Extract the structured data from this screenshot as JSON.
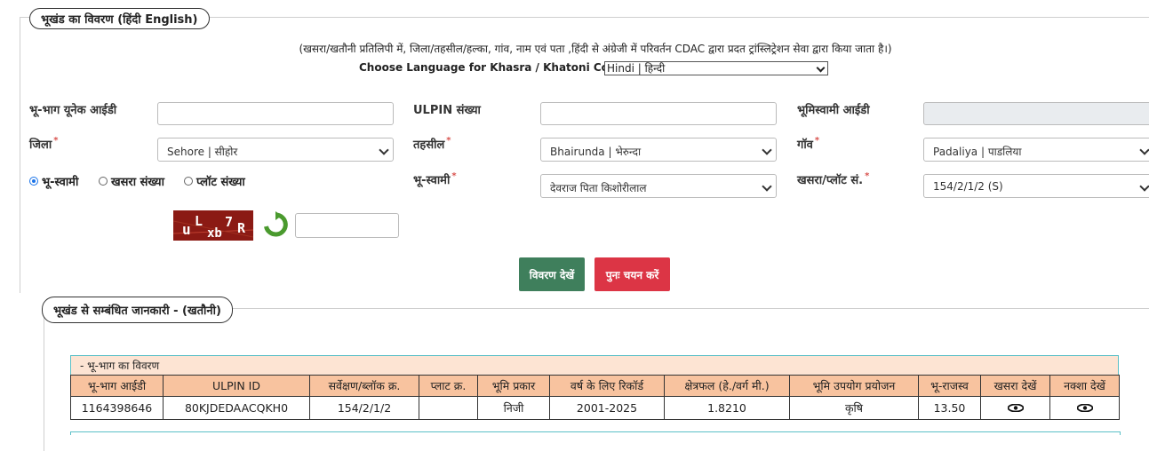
{
  "section1": {
    "legend": "भूखंड का विवरण  (हिंदी  English)",
    "note": "(खसरा/खतौनी प्रतिलिपी में, जिला/तहसील/हल्का, गांव, नाम एवं पता ,हिंदी से अंग्रेजी में परिवर्तन CDAC द्वारा प्रदत ट्रांस्लिट्रेशन सेवा द्वारा किया जाता है।)",
    "lang_label": "Choose Language for Khasra / Khatoni Copy:",
    "lang_value": "Hindi | हिन्दी"
  },
  "form": {
    "unique_id_label": "भू-भाग यूनेक आईडी",
    "ulpin_label": "ULPIN संख्या",
    "owner_id_label": "भूमिस्वामी आईडी",
    "district_label": "जिला",
    "district_value": "Sehore | सीहोर",
    "tehsil_label": "तहसील",
    "tehsil_value": "Bhairunda | भेरुन्दा",
    "village_label": "गॉव",
    "village_value": "Padaliya | पाडलिया",
    "radio_owner": "भू-स्वामी",
    "radio_khasra": "खसरा संख्या",
    "radio_plot": "प्लॉट संख्या",
    "owner_label": "भू-स्वामी",
    "owner_value": "देवराज पिता किशोरीलाल",
    "khasra_label": "खसरा/प्लॉट सं.",
    "khasra_value": "154/2/1/2 (S)",
    "required_mark": "*",
    "captcha_text": "uLxb7R",
    "view_button": "विवरण देखें",
    "reset_button": "पुनः चयन करें"
  },
  "section2": {
    "legend": "भूखंड से सम्बंधित जानकारी -   (खतौनी)",
    "caption": "- भू-भाग का विवरण",
    "headers": [
      "भू-भाग आईडी",
      "ULPIN ID",
      "सर्वेक्षण/ब्लॉक क्र.",
      "प्लाट क्र.",
      "भूमि प्रकार",
      "वर्ष के लिए रिकॉर्ड",
      "क्षेत्रफल (हे./वर्ग मी.)",
      "भूमि उपयोग प्रयोजन",
      "भू-राजस्व",
      "खसरा देखें",
      "नक्शा देखें"
    ],
    "row": [
      "1164398646",
      "80KJDEDAACQKH0",
      "154/2/1/2",
      "",
      "निजी",
      "2001-2025",
      "1.8210",
      "कृषि",
      "13.50"
    ]
  }
}
